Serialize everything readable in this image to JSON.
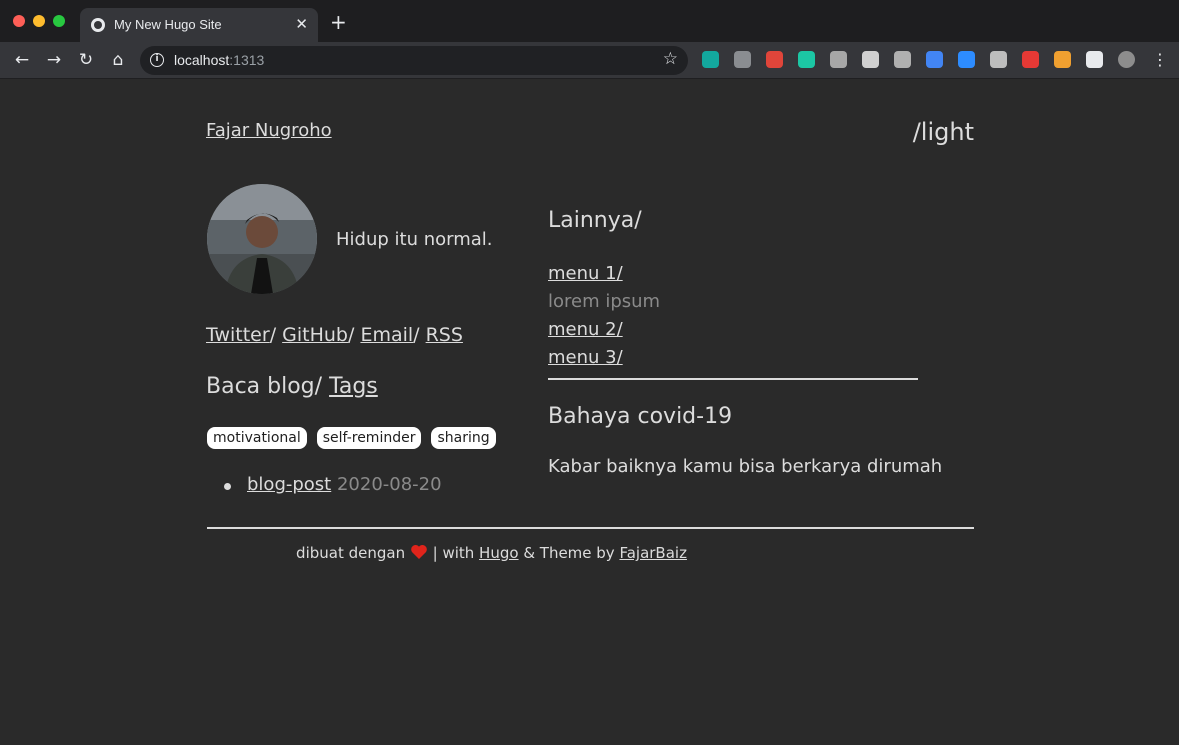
{
  "browser": {
    "tab_title": "My New Hugo Site",
    "tab_close": "✕",
    "new_tab": "+",
    "url_host": "localhost",
    "url_port": ":1313",
    "star": "☆",
    "extensions": [
      {
        "name": "m-extension-icon",
        "color": "#13a89e"
      },
      {
        "name": "lightbulb-extension-icon",
        "color": "#8a8d91"
      },
      {
        "name": "color-wheel-extension-icon",
        "color": "#e0453a"
      },
      {
        "name": "n-extension-icon",
        "color": "#1cc7a4"
      },
      {
        "name": "pig-extension-icon",
        "color": "#a7a7a7"
      },
      {
        "name": "speedometer-extension-icon",
        "color": "#d0d0d0"
      },
      {
        "name": "gear-extension-icon",
        "color": "#b0b0b0"
      },
      {
        "name": "translate-extension-icon",
        "color": "#4285f4"
      },
      {
        "name": "zoom-extension-icon",
        "color": "#2d8cff"
      },
      {
        "name": "office-extension-icon",
        "color": "#bdbdbd"
      },
      {
        "name": "rocket-extension-icon",
        "color": "#e53935"
      },
      {
        "name": "mushroom-extension-icon",
        "color": "#f0a030"
      },
      {
        "name": "puzzle-extension-icon",
        "color": "#e8eaed"
      },
      {
        "name": "profile-avatar-icon",
        "color": "#8d8d8d"
      }
    ]
  },
  "site": {
    "title": "Fajar Nugroho",
    "theme_toggle": "/light",
    "tagline": "Hidup itu normal.",
    "social": [
      {
        "label": "Twitter"
      },
      {
        "label": "GitHub"
      },
      {
        "label": "Email"
      },
      {
        "label": "RSS"
      }
    ],
    "separator": "/ ",
    "blog_heading_prefix": "Baca blog/ ",
    "blog_heading_link": "Tags",
    "tags": [
      "motivational",
      "self-reminder",
      "sharing"
    ],
    "posts": [
      {
        "title": "blog-post",
        "date": "2020-08-20"
      }
    ]
  },
  "sidebar": {
    "heading": "Lainnya/",
    "menu": [
      {
        "label": "menu 1/",
        "link": true
      },
      {
        "label": "lorem ipsum",
        "link": false
      },
      {
        "label": "menu 2/",
        "link": true
      },
      {
        "label": "menu 3/",
        "link": true
      }
    ],
    "covid_title": "Bahaya covid-19",
    "covid_text": "Kabar baiknya kamu bisa berkarya dirumah"
  },
  "footer": {
    "prefix": "dibuat dengan ",
    "middle": " | with ",
    "hugo": "Hugo",
    "theme_by": " & Theme by ",
    "author": "FajarBaiz"
  }
}
